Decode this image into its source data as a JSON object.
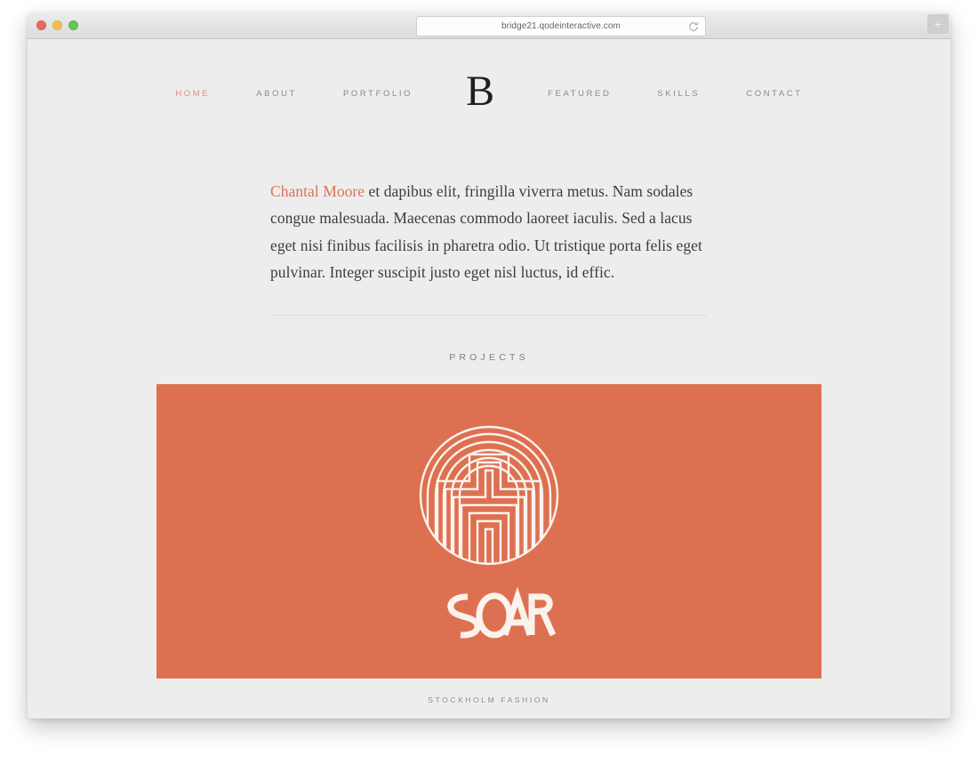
{
  "browser": {
    "url": "bridge21.qodeinteractive.com",
    "reload_icon": "reload-icon",
    "new_tab_label": "+",
    "traffic_lights": [
      {
        "name": "close",
        "color": "#e9685d"
      },
      {
        "name": "minimize",
        "color": "#f2bf4f"
      },
      {
        "name": "zoom",
        "color": "#62c554"
      }
    ]
  },
  "site": {
    "logo": "B",
    "nav": [
      {
        "label": "HOME",
        "active": true
      },
      {
        "label": "ABOUT",
        "active": false
      },
      {
        "label": "PORTFOLIO",
        "active": false
      },
      {
        "label": "FEATURED",
        "active": false
      },
      {
        "label": "SKILLS",
        "active": false
      },
      {
        "label": "CONTACT",
        "active": false
      }
    ],
    "intro": {
      "name": "Chantal Moore",
      "body": " et dapibus elit, fringilla viverra metus. Nam sodales congue malesuada. Maecenas commodo laoreet iaculis. Sed a lacus eget nisi finibus facilisis in pharetra odio. Ut tristique porta felis eget pulvinar. Integer suscipit justo eget nisl luctus, id effic."
    },
    "projects": {
      "heading": "PROJECTS",
      "items": [
        {
          "caption": "STOCKHOLM FASHION",
          "artwork_name": "soar-logo-mark",
          "wordmark": "SOAR",
          "background_color": "#de7052",
          "mark_color": "#faf3ec"
        }
      ]
    }
  },
  "colors": {
    "page_background": "#eeeded",
    "accent": "#d9725a",
    "nav_active": "#e08d79",
    "nav_default": "#8a8a8a",
    "text": "#3c3c3c",
    "divider": "#dedede"
  }
}
